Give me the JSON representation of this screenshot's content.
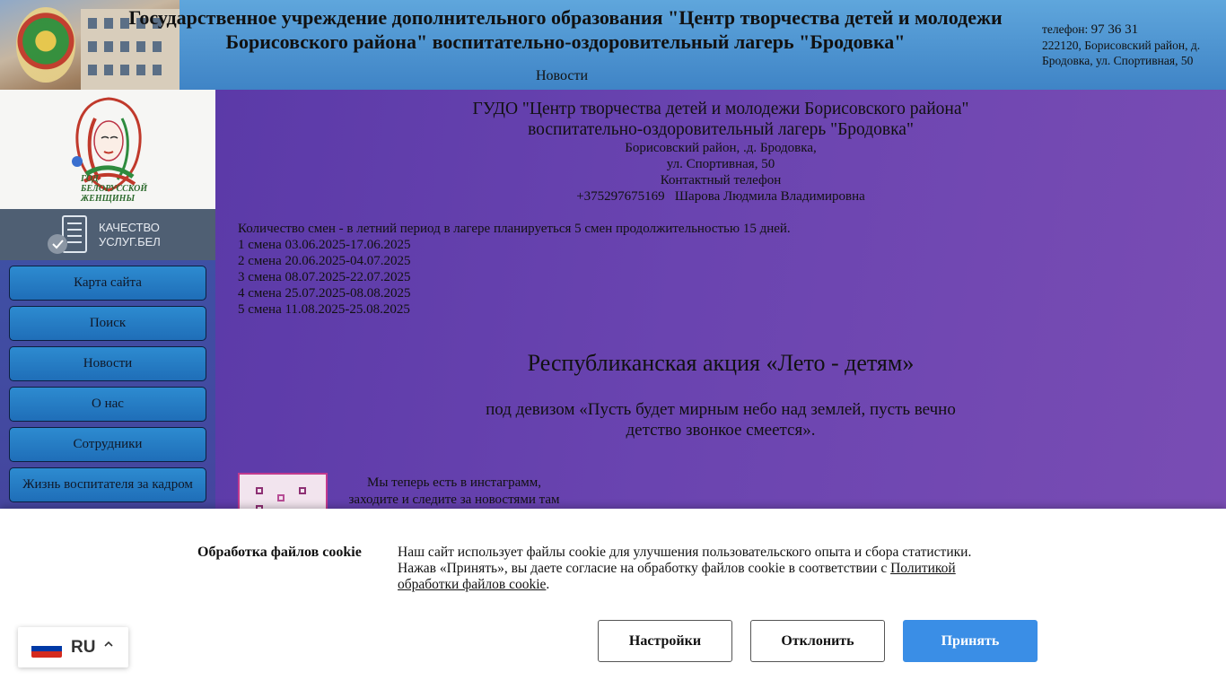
{
  "header": {
    "title": "Государственное учреждение дополнительного образования \"Центр творчества детей и молодежи Борисовского района\" воспитательно-оздоровительный лагерь \"Бродовка\"",
    "news_link": "Новости",
    "phone_label": "телефон:",
    "phone_value": "97 36 31",
    "address": "222120, Борисовский район, д. Бродовка, ул. Спортивная, 50"
  },
  "sidebar": {
    "promo_caption": "Год белорусской женщины",
    "quality_label_line1": "КАЧЕСТВО",
    "quality_label_line2": "УСЛУГ.БЕЛ",
    "nav": [
      "Карта сайта",
      "Поиск",
      "Новости",
      "О нас",
      "Сотрудники",
      "Жизнь воспитателя за кадром"
    ]
  },
  "main": {
    "org_name_line1": "ГУДО \"Центр творчества детей и молодежи Борисовского района\"",
    "org_name_line2": "воспитательно-оздоровительный лагерь \"Бродовка\"",
    "address_line1": "Борисовский район, .д. Бродовка,",
    "address_line2": "ул. Спортивная, 50",
    "contact_label": "Контактный телефон",
    "contact_value": "+375297675169   Шарова Людмила Владимировна",
    "shifts_intro": "Количество смен - в летний период в лагере планируеться 5 смен продолжительностью 15 дней.",
    "shifts": [
      "1 смена 03.06.2025-17.06.2025",
      "2 смена 20.06.2025-04.07.2025",
      "3 смена 08.07.2025-22.07.2025",
      "4 смена 25.07.2025-08.08.2025",
      "5 смена 11.08.2025-25.08.2025"
    ],
    "action_title": "Республиканская акция «Лето - детям»",
    "action_motto": "под девизом «Пусть будет мирным небо над землей, пусть вечно детство звонкое смеется».",
    "insta_line1": "Мы теперь есть в инстаграмм,",
    "insta_line2": "заходите и следите за новостями там"
  },
  "cookie": {
    "title": "Обработка файлов cookie",
    "text_before": "Наш сайт использует файлы cookie для улучшения пользовательского опыта и сбора статистики. Нажав «Принять», вы даете согласие на обработку файлов cookie в соответствии с ",
    "policy_link": "Политикой обработки файлов cookie",
    "text_after": ".",
    "settings_button": "Настройки",
    "reject_button": "Отклонить",
    "accept_button": "Принять"
  },
  "language": {
    "code": "RU",
    "flag_colors": [
      "#ffffff",
      "#0039a6",
      "#d52b1e"
    ]
  },
  "colors": {
    "header_bg": "#4a8fd0",
    "nav_button": "#2576c0",
    "accept_button": "#3a8ee6",
    "main_bg": "#6242ac"
  }
}
